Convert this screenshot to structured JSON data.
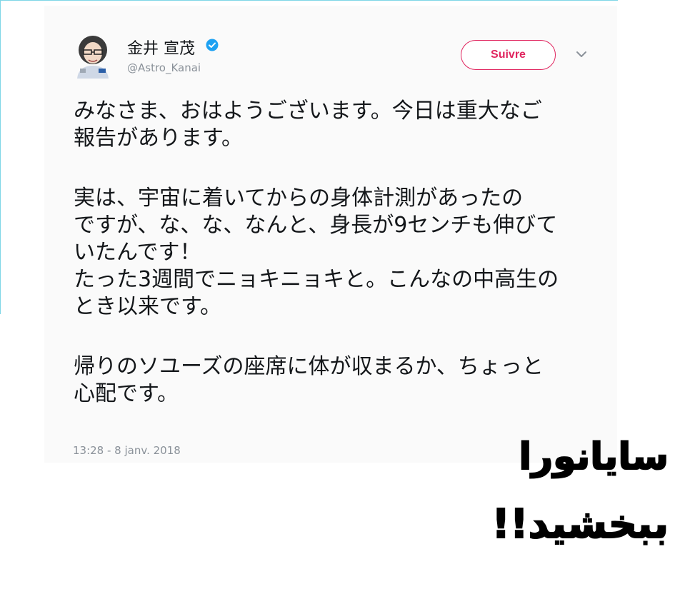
{
  "tweet": {
    "display_name": "金井 宣茂",
    "handle": "@Astro_Kanai",
    "follow_label": "Suivre",
    "text_lines": [
      "みなさま、おはようございます。今日は重大なご",
      "報告があります。",
      "",
      "実は、宇宙に着いてからの身体計測があったの",
      "ですが、な、な、なんと、身長が9センチも伸びて",
      "いたんです！",
      "たった3週間でニョキニョキと。こんなの中高生の",
      "とき以来です。",
      "",
      "帰りのソユーズの座席に体が収まるか、ちょっと",
      "心配です。"
    ],
    "timestamp": "13:28 - 8 janv. 2018",
    "icons": {
      "avatar": "avatar-astronaut-portrait",
      "verified": "verified-badge-icon",
      "menu": "chevron-down-icon"
    },
    "colors": {
      "follow_accent": "#e0245e",
      "verified_blue": "#1da1f2",
      "secondary_text": "#8a9199"
    }
  },
  "caption": {
    "line1": "سایانورا",
    "line2": "ببخشید!!"
  }
}
